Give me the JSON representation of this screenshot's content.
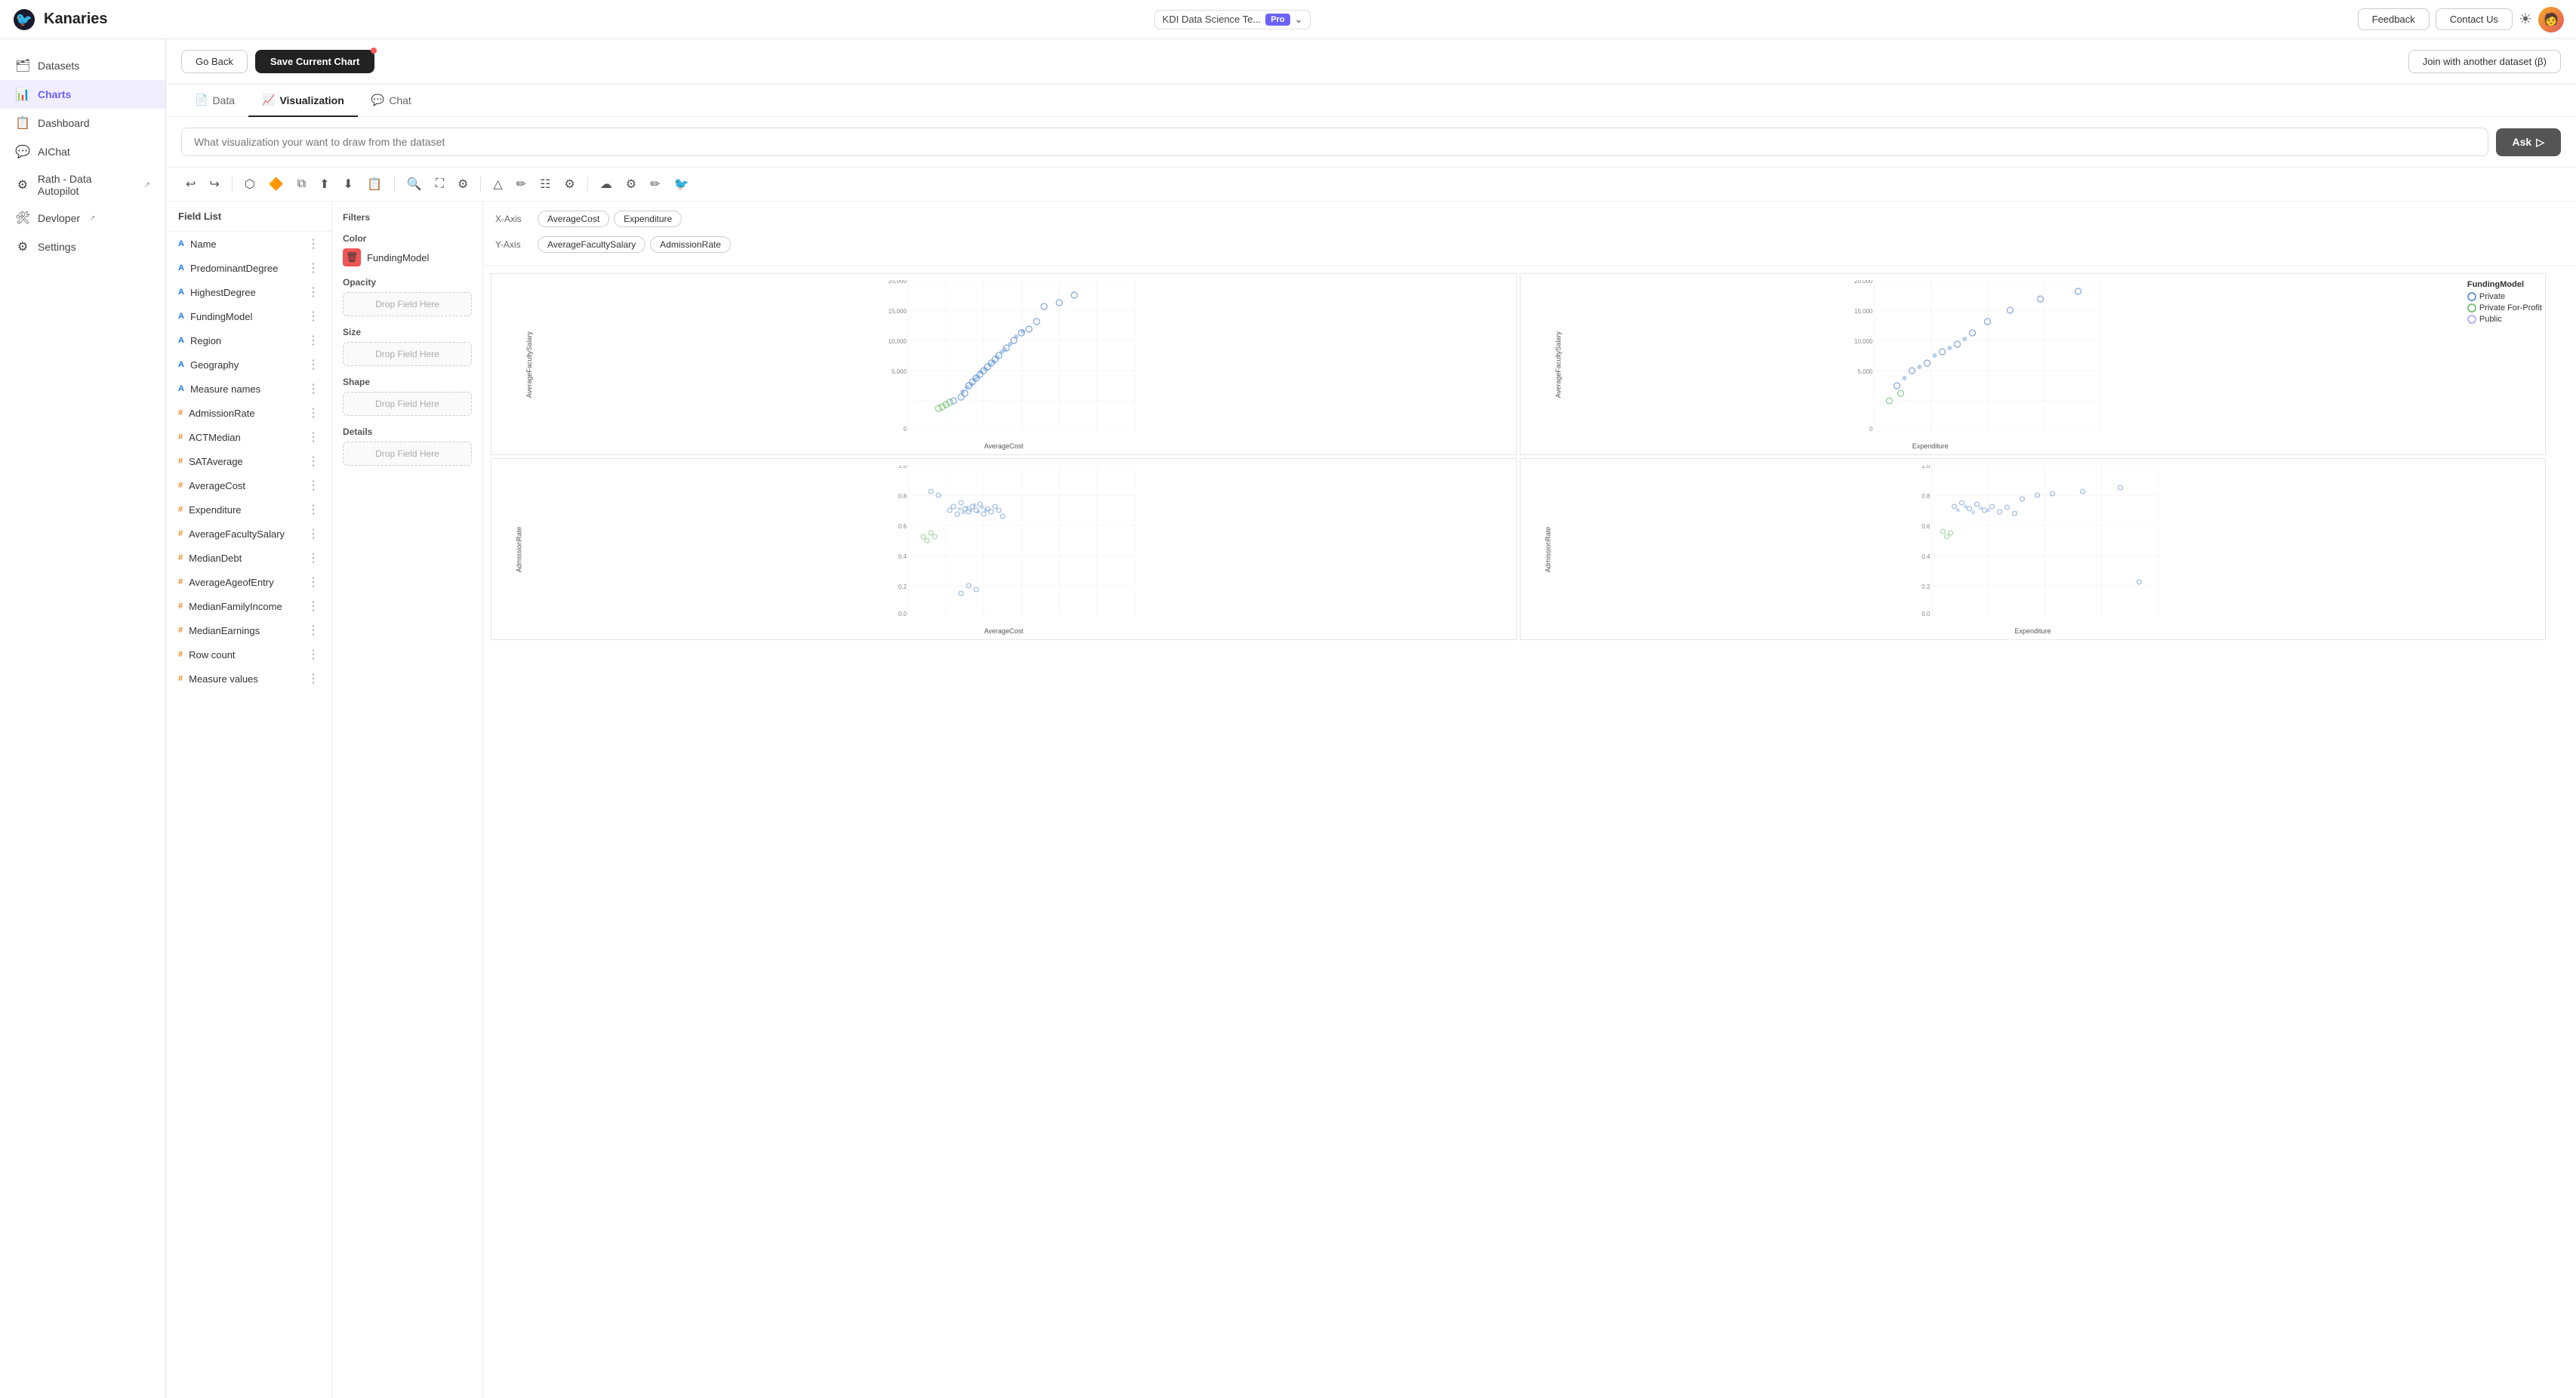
{
  "app": {
    "name": "Kanaries",
    "logo_emoji": "🐦"
  },
  "topnav": {
    "workspace": "KDI Data Science Te...",
    "pro_label": "Pro",
    "feedback_label": "Feedback",
    "contact_label": "Contact Us",
    "theme_icon": "☀",
    "avatar_emoji": "🧑"
  },
  "sidebar": {
    "items": [
      {
        "id": "datasets",
        "label": "Datasets",
        "icon": "🗂"
      },
      {
        "id": "charts",
        "label": "Charts",
        "icon": "📊",
        "active": true
      },
      {
        "id": "dashboard",
        "label": "Dashboard",
        "icon": "📋"
      },
      {
        "id": "aichat",
        "label": "AIChat",
        "icon": "💬"
      },
      {
        "id": "rath",
        "label": "Rath - Data Autopilot",
        "icon": "⚙",
        "ext": "↗"
      },
      {
        "id": "developer",
        "label": "Devloper",
        "icon": "🛠",
        "ext": "↗"
      },
      {
        "id": "settings",
        "label": "Settings",
        "icon": "⚙"
      }
    ]
  },
  "actionbar": {
    "goback_label": "Go Back",
    "save_label": "Save Current Chart",
    "join_label": "Join with another dataset (β)"
  },
  "tabs": [
    {
      "id": "data",
      "label": "Data",
      "icon": "📄"
    },
    {
      "id": "visualization",
      "label": "Visualization",
      "icon": "📈",
      "active": true
    },
    {
      "id": "chat",
      "label": "Chat",
      "icon": "💬"
    }
  ],
  "query": {
    "placeholder": "What visualization your want to draw from the dataset",
    "ask_label": "Ask"
  },
  "toolbar": {
    "buttons": [
      "↩",
      "↪",
      "⬡",
      "🔶",
      "⧉",
      "⬆",
      "⬇",
      "📋",
      "🔍",
      "⛶",
      "⚙",
      "△",
      "✏",
      "☷",
      "⚙",
      "☁",
      "⚙",
      "✏",
      "🐦"
    ]
  },
  "fieldlist": {
    "header": "Field List",
    "fields": [
      {
        "name": "Name",
        "type": "str"
      },
      {
        "name": "PredominantDegree",
        "type": "str"
      },
      {
        "name": "HighestDegree",
        "type": "str"
      },
      {
        "name": "FundingModel",
        "type": "str"
      },
      {
        "name": "Region",
        "type": "str"
      },
      {
        "name": "Geography",
        "type": "str"
      },
      {
        "name": "Measure names",
        "type": "str"
      },
      {
        "name": "AdmissionRate",
        "type": "num"
      },
      {
        "name": "ACTMedian",
        "type": "num"
      },
      {
        "name": "SATAverage",
        "type": "num"
      },
      {
        "name": "AverageCost",
        "type": "num"
      },
      {
        "name": "Expenditure",
        "type": "num"
      },
      {
        "name": "AverageFacultySalary",
        "type": "num"
      },
      {
        "name": "MedianDebt",
        "type": "num"
      },
      {
        "name": "AverageAgeofEntry",
        "type": "num"
      },
      {
        "name": "MedianFamilyIncome",
        "type": "num"
      },
      {
        "name": "MedianEarnings",
        "type": "num"
      },
      {
        "name": "Row count",
        "type": "num"
      },
      {
        "name": "Measure values",
        "type": "num"
      }
    ]
  },
  "controls": {
    "filters_label": "Filters",
    "color_label": "Color",
    "color_field": "FundingModel",
    "opacity_label": "Opacity",
    "size_label": "Size",
    "shape_label": "Shape",
    "details_label": "Details",
    "drop_text": "Drop Field Here"
  },
  "axes": {
    "xaxis_label": "X-Axis",
    "yaxis_label": "Y-Axis",
    "xaxis_fields": [
      "AverageCost",
      "Expenditure"
    ],
    "yaxis_fields": [
      "AverageFacultySalary",
      "AdmissionRate"
    ]
  },
  "legend": {
    "title": "FundingModel",
    "items": [
      {
        "label": "Private",
        "color": "#4a90d9"
      },
      {
        "label": "Private For-Profit",
        "color": "#5ab85a"
      },
      {
        "label": "Public",
        "color": "#a0a0f0"
      }
    ]
  },
  "charts": [
    {
      "id": "tl",
      "xField": "AverageCost",
      "yField": "AverageFacultySalary",
      "xLabel": "AverageCost",
      "yLabel": "AverageFacultySalary",
      "xMax": "60,000",
      "yMax": "20,000"
    },
    {
      "id": "tr",
      "xField": "Expenditure",
      "yField": "AverageFacultySalary",
      "xLabel": "Expenditure",
      "yLabel": "AverageFacultySalary",
      "xMax": "100,000",
      "yMax": "20,000"
    },
    {
      "id": "bl",
      "xField": "AverageCost",
      "yField": "AdmissionRate",
      "xLabel": "AverageCost",
      "yLabel": "AdmissionRate",
      "xMax": "60,000",
      "yMax": "1.0"
    },
    {
      "id": "br",
      "xField": "Expenditure",
      "yField": "AdmissionRate",
      "xLabel": "Expenditure",
      "yLabel": "AdmissionRate",
      "xMax": "100,000",
      "yMax": "1.0"
    }
  ]
}
